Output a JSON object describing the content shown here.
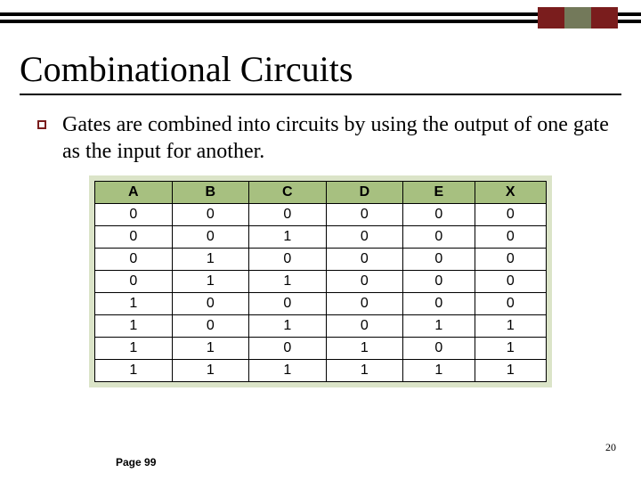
{
  "title": "Combinational Circuits",
  "body_text": "Gates are combined into circuits by using the output of one gate as the input for another.",
  "page_ref": "Page 99",
  "slide_number": "20",
  "chart_data": {
    "type": "table",
    "headers": [
      "A",
      "B",
      "C",
      "D",
      "E",
      "X"
    ],
    "rows": [
      [
        "0",
        "0",
        "0",
        "0",
        "0",
        "0"
      ],
      [
        "0",
        "0",
        "1",
        "0",
        "0",
        "0"
      ],
      [
        "0",
        "1",
        "0",
        "0",
        "0",
        "0"
      ],
      [
        "0",
        "1",
        "1",
        "0",
        "0",
        "0"
      ],
      [
        "1",
        "0",
        "0",
        "0",
        "0",
        "0"
      ],
      [
        "1",
        "0",
        "1",
        "0",
        "1",
        "1"
      ],
      [
        "1",
        "1",
        "0",
        "1",
        "0",
        "1"
      ],
      [
        "1",
        "1",
        "1",
        "1",
        "1",
        "1"
      ]
    ]
  }
}
